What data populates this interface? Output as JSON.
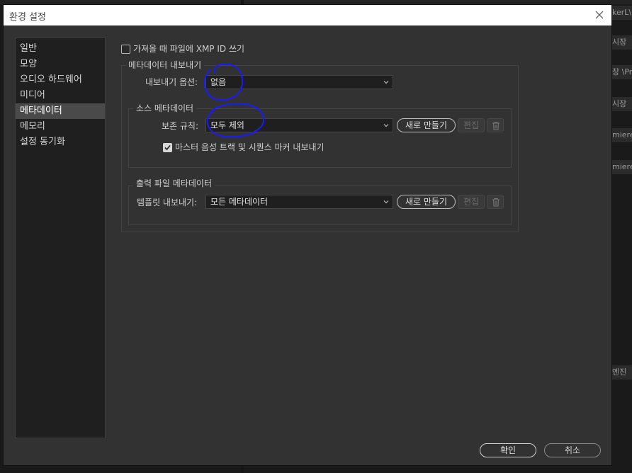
{
  "background": {
    "strips": [
      "kerL\\ 습",
      "시장",
      "장 \\Pr",
      "시장",
      "miere F",
      "miere P",
      "엔진"
    ]
  },
  "dialog": {
    "title": "환경 설정",
    "close_icon": "close-icon"
  },
  "sidebar": {
    "items": [
      {
        "label": "일반",
        "active": false
      },
      {
        "label": "모양",
        "active": false
      },
      {
        "label": "오디오 하드웨어",
        "active": false
      },
      {
        "label": "미디어",
        "active": false
      },
      {
        "label": "메타데이터",
        "active": true
      },
      {
        "label": "메모리",
        "active": false
      },
      {
        "label": "설정 동기화",
        "active": false
      }
    ]
  },
  "content": {
    "xmp_checkbox": {
      "label": "가져올 때 파일에 XMP ID 쓰기",
      "checked": false
    },
    "export_group": {
      "title": "메타데이터 내보내기",
      "export_option": {
        "label": "내보내기 옵션:",
        "value": "없음"
      },
      "source_group": {
        "title": "소스 메타데이터",
        "retention_rule": {
          "label": "보존 규칙:",
          "value": "모두 제외"
        },
        "new_button": "새로 만들기",
        "edit_button": "편집",
        "delete_icon": "trash-icon",
        "marker_checkbox": {
          "label": "마스터 음성 트랙 및 시퀀스 마커 내보내기",
          "checked": true
        }
      },
      "output_group": {
        "title": "출력 파일 메타데이터",
        "template_export": {
          "label": "템플릿 내보내기:",
          "value": "모든 메타데이터"
        },
        "new_button": "새로 만들기",
        "edit_button": "편집",
        "delete_icon": "trash-icon"
      }
    }
  },
  "footer": {
    "ok_button": "확인",
    "cancel_button": "취소"
  },
  "colors": {
    "dialog_bg": "#323232",
    "titlebar_bg": "#ffffff",
    "sidebar_active": "#4a4a4a",
    "annotation": "#1a1aff"
  }
}
